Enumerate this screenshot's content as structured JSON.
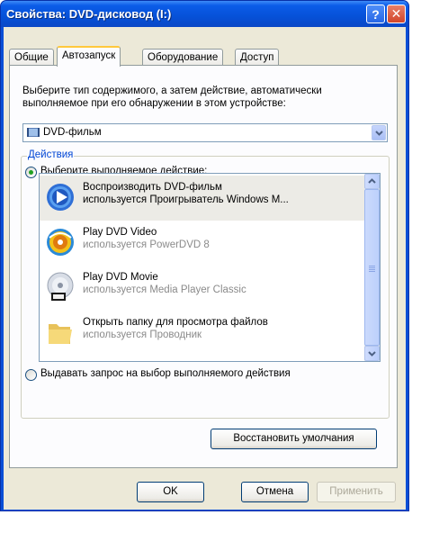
{
  "window": {
    "title": "Свойства: DVD-дисковод (I:)",
    "help_label": "?",
    "close_label": "✕"
  },
  "tabs": [
    {
      "label": "Общие"
    },
    {
      "label": "Автозапуск"
    },
    {
      "label": "Оборудование"
    },
    {
      "label": "Доступ"
    }
  ],
  "autorun": {
    "intro_line1": "Выберите тип содержимого, а затем действие, автоматически",
    "intro_line2": "выполняемое при его обнаружении в этом устройстве:",
    "content_type": "DVD-фильм",
    "group_label": "Действия",
    "radio_select_label": "Выберите выполняемое действие:",
    "radio_prompt_label": "Выдавать запрос на выбор выполняемого действия",
    "actions": [
      {
        "title": "Воспроизводить DVD-фильм",
        "subtitle": "используется Проигрыватель Windows M...",
        "icon": "windows-media-player-icon"
      },
      {
        "title": "Play DVD Video",
        "subtitle": "используется PowerDVD 8",
        "icon": "powerdvd-icon"
      },
      {
        "title": "Play DVD Movie",
        "subtitle": "используется Media Player Classic",
        "icon": "dvd-disc-icon"
      },
      {
        "title": "Открыть папку для просмотра файлов",
        "subtitle": "используется Проводник",
        "icon": "folder-icon"
      }
    ],
    "restore_defaults_label": "Восстановить умолчания"
  },
  "footer": {
    "ok_label": "OK",
    "cancel_label": "Отмена",
    "apply_label": "Применить"
  },
  "colors": {
    "titlebar": "#0651d8",
    "dialog_bg": "#ece9d8",
    "group_label": "#0046d5",
    "tab_highlight": "#ffc83c"
  }
}
